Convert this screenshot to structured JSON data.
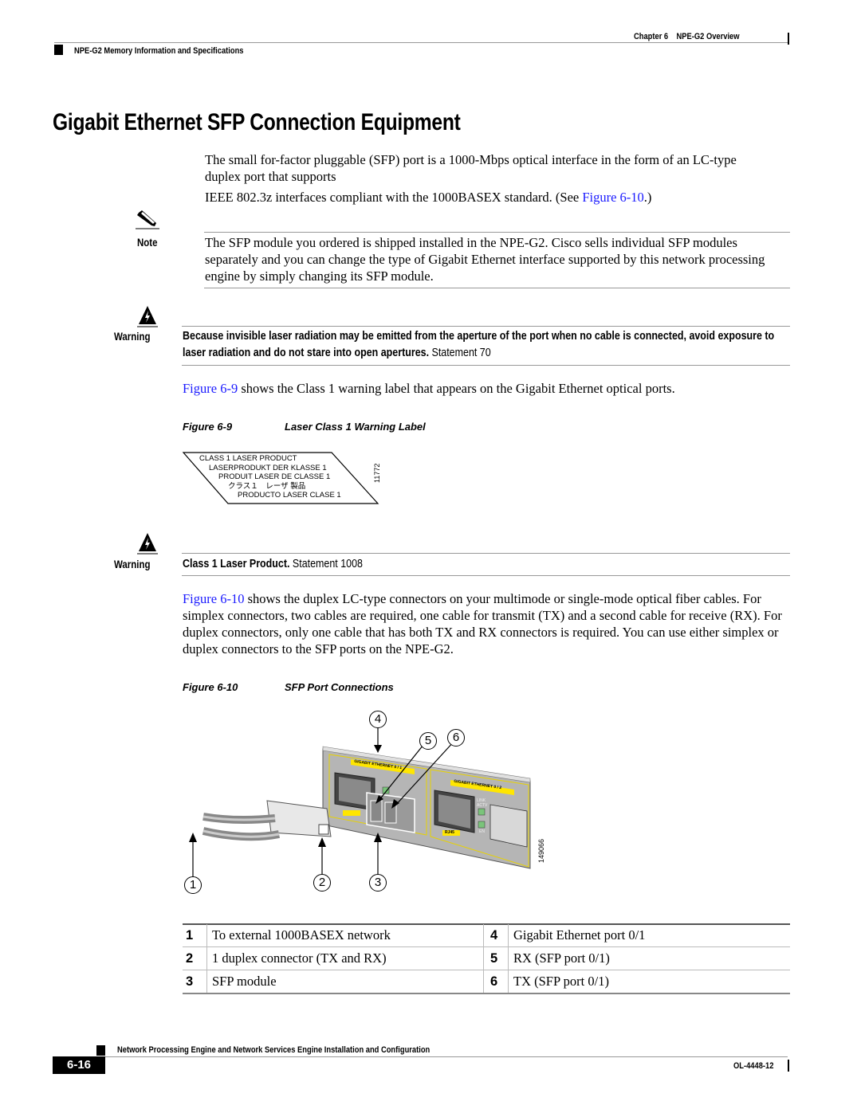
{
  "header": {
    "chapter": "Chapter 6",
    "chapter_title": "NPE-G2 Overview",
    "section": "NPE-G2 Memory Information and Specifications"
  },
  "main": {
    "title": "Gigabit Ethernet SFP Connection Equipment",
    "intro_line1": "The small for-factor pluggable (SFP) port is a 1000-Mbps optical interface in the form of an LC-type",
    "intro_line2": "duplex port that supports",
    "intro_line3_pre": "IEEE 802.3z interfaces compliant with the 1000BASEX standard. (See ",
    "intro_line3_link": "Figure 6-10",
    "intro_line3_post": ".)",
    "note": {
      "label": "Note",
      "icon": "pencil-icon",
      "text": "The SFP module you ordered is shipped installed in the NPE-G2. Cisco sells individual SFP modules separately and you can change the type of Gigabit Ethernet interface supported by this network processing engine by simply changing its SFP module."
    },
    "warning1": {
      "label": "Warning",
      "icon": "warning-triangle-icon",
      "bold_text": "Because invisible laser radiation may be emitted from the aperture of the port when no cable is connected, avoid exposure to laser radiation and do not stare into open apertures.",
      "statement": " Statement 70"
    },
    "fig9_ref_link": "Figure 6-9",
    "fig9_ref_text": " shows the Class 1 warning label that appears on the Gigabit Ethernet optical ports.",
    "figure9": {
      "number": "Figure 6-9",
      "caption": "Laser Class 1 Warning Label",
      "label_lines": [
        "CLASS 1 LASER PRODUCT",
        "LASERPRODUKT DER KLASSE 1",
        "PRODUIT LASER DE CLASSE 1",
        "クラス１　レーザ 製品",
        "PRODUCTO LASER CLASE 1"
      ],
      "art_id": "11772"
    },
    "warning2": {
      "label": "Warning",
      "icon": "warning-triangle-icon",
      "bold_text": "Class 1 Laser Product.",
      "statement": " Statement 1008"
    },
    "fig10_ref_link": "Figure 6-10",
    "fig10_ref_text": " shows the duplex LC-type connectors on your multimode or single-mode optical fiber cables. For simplex connectors, two cables are required, one cable for transmit (TX) and a second cable for receive (RX). For duplex connectors, only one cable that has both TX and RX connectors is required. You can use either simplex or duplex connectors to the SFP ports on the NPE-G2.",
    "figure10": {
      "number": "Figure 6-10",
      "caption": "SFP Port Connections",
      "port1_label": "GIGABIT ETHERNET 0 / 1",
      "port2_label": "GIGABIT ETHERNET 0 / 2",
      "rj45": "RJ45",
      "link": "LINK",
      "actv": "ACTV",
      "en": "EN",
      "art_id": "149066",
      "callouts": [
        "1",
        "2",
        "3",
        "4",
        "5",
        "6"
      ]
    },
    "legend": [
      {
        "n1": "1",
        "d1": "To external 1000BASEX network",
        "n2": "4",
        "d2": "Gigabit Ethernet port 0/1"
      },
      {
        "n1": "2",
        "d1": "1 duplex connector (TX and RX)",
        "n2": "5",
        "d2": "RX (SFP port 0/1)"
      },
      {
        "n1": "3",
        "d1": "SFP module",
        "n2": "6",
        "d2": "TX (SFP port 0/1)"
      }
    ]
  },
  "footer": {
    "book_title": "Network Processing Engine and Network Services Engine Installation and Configuration",
    "page_number": "6-16",
    "doc_id": "OL-4448-12"
  }
}
